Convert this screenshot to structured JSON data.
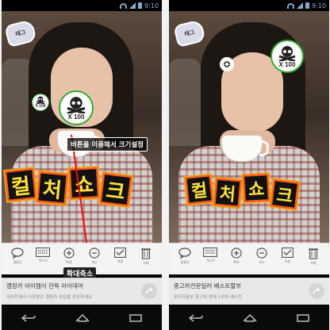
{
  "statusbar": {
    "left_time": "9:10",
    "right_time": "9:10"
  },
  "left_screen": {
    "hint_caption": "버튼을 이용해서 크기설정",
    "zoom_label": "확대축소",
    "skull_large_count": "X 100",
    "skull_small_count": "X 100",
    "tag_label": "태그",
    "title_chars": [
      "컬",
      "처",
      "쇼",
      "크"
    ],
    "title_accent": "+",
    "ad_title": "캠핑카 아이템이 잔뜩 아이데어",
    "ad_subtitle": "사이트에서 다운받은 캠핑카 모습을 감상하세요"
  },
  "right_screen": {
    "skull_count": "X 100",
    "tag_label": "태그",
    "title_chars": [
      "컬",
      "처",
      "쇼",
      "크"
    ],
    "ad_title": "중고차전문딜러 베스트할부",
    "ad_subtitle": "무이자할부 중고차 판매 1위의 베스트"
  },
  "toolbar": {
    "tools": [
      {
        "name": "speech-bubble-icon",
        "label": "말풍선"
      },
      {
        "name": "keyboard-icon",
        "label": "텍스트"
      },
      {
        "name": "zoom-in-icon",
        "label": "확대"
      },
      {
        "name": "zoom-out-icon",
        "label": "축소"
      },
      {
        "name": "check-icon",
        "label": "적용"
      },
      {
        "name": "trash-icon",
        "label": "삭제"
      }
    ]
  },
  "colors": {
    "title_text": "#ffe23b",
    "title_border": "#ff5a1f",
    "hint_line": "#ee1111",
    "skull_ring": "#33aa33"
  }
}
